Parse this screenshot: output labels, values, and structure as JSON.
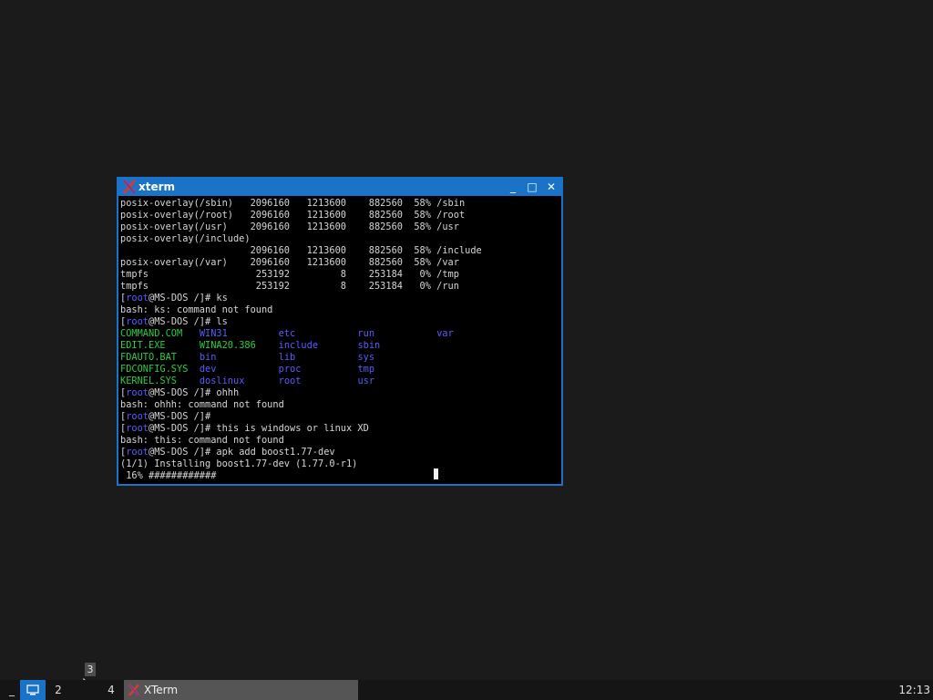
{
  "window": {
    "title": "xterm",
    "minimize_glyph": "_",
    "maximize_glyph": "□",
    "close_glyph": "✕"
  },
  "terminal": {
    "lines": [
      [
        {
          "t": "posix-overlay(/sbin)   2096160   1213600    882560  58% /sbin"
        }
      ],
      [
        {
          "t": "posix-overlay(/root)   2096160   1213600    882560  58% /root"
        }
      ],
      [
        {
          "t": "posix-overlay(/usr)    2096160   1213600    882560  58% /usr"
        }
      ],
      [
        {
          "t": "posix-overlay(/include)"
        }
      ],
      [
        {
          "t": "                       2096160   1213600    882560  58% /include"
        }
      ],
      [
        {
          "t": "posix-overlay(/var)    2096160   1213600    882560  58% /var"
        }
      ],
      [
        {
          "t": "tmpfs                   253192         8    253184   0% /tmp"
        }
      ],
      [
        {
          "t": "tmpfs                   253192         8    253184   0% /run"
        }
      ],
      [
        {
          "t": "["
        },
        {
          "t": "root",
          "c": "#5a5aff"
        },
        {
          "t": "@MS-DOS /]# ks"
        }
      ],
      [
        {
          "t": "bash: ks: command not found"
        }
      ],
      [
        {
          "t": "["
        },
        {
          "t": "root",
          "c": "#5a5aff"
        },
        {
          "t": "@MS-DOS /]# ls"
        }
      ],
      [
        {
          "t": "COMMAND.COM",
          "c": "#2ecc40"
        },
        {
          "t": "   "
        },
        {
          "t": "WIN31",
          "c": "#5a5aff"
        },
        {
          "t": "         "
        },
        {
          "t": "etc",
          "c": "#5a5aff"
        },
        {
          "t": "           "
        },
        {
          "t": "run",
          "c": "#5a5aff"
        },
        {
          "t": "           "
        },
        {
          "t": "var",
          "c": "#5a5aff"
        }
      ],
      [
        {
          "t": "EDIT.EXE",
          "c": "#2ecc40"
        },
        {
          "t": "      "
        },
        {
          "t": "WINA20.386",
          "c": "#2ecc40"
        },
        {
          "t": "    "
        },
        {
          "t": "include",
          "c": "#5a5aff"
        },
        {
          "t": "       "
        },
        {
          "t": "sbin",
          "c": "#5a5aff"
        }
      ],
      [
        {
          "t": "FDAUTO.BAT",
          "c": "#2ecc40"
        },
        {
          "t": "    "
        },
        {
          "t": "bin",
          "c": "#5a5aff"
        },
        {
          "t": "           "
        },
        {
          "t": "lib",
          "c": "#5a5aff"
        },
        {
          "t": "           "
        },
        {
          "t": "sys",
          "c": "#5a5aff"
        }
      ],
      [
        {
          "t": "FDCONFIG.SYS",
          "c": "#2ecc40"
        },
        {
          "t": "  "
        },
        {
          "t": "dev",
          "c": "#5a5aff"
        },
        {
          "t": "           "
        },
        {
          "t": "proc",
          "c": "#5a5aff"
        },
        {
          "t": "          "
        },
        {
          "t": "tmp",
          "c": "#5a5aff"
        }
      ],
      [
        {
          "t": "KERNEL.SYS",
          "c": "#2ecc40"
        },
        {
          "t": "    "
        },
        {
          "t": "doslinux",
          "c": "#5a5aff"
        },
        {
          "t": "      "
        },
        {
          "t": "root",
          "c": "#5a5aff"
        },
        {
          "t": "          "
        },
        {
          "t": "usr",
          "c": "#5a5aff"
        }
      ],
      [
        {
          "t": "["
        },
        {
          "t": "root",
          "c": "#5a5aff"
        },
        {
          "t": "@MS-DOS /]# ohhh"
        }
      ],
      [
        {
          "t": "bash: ohhh: command not found"
        }
      ],
      [
        {
          "t": "["
        },
        {
          "t": "root",
          "c": "#5a5aff"
        },
        {
          "t": "@MS-DOS /]#"
        }
      ],
      [
        {
          "t": "["
        },
        {
          "t": "root",
          "c": "#5a5aff"
        },
        {
          "t": "@MS-DOS /]# this is windows or linux XD"
        }
      ],
      [
        {
          "t": "bash: this: command not found"
        }
      ],
      [
        {
          "t": "["
        },
        {
          "t": "root",
          "c": "#5a5aff"
        },
        {
          "t": "@MS-DOS /]# apk add boost1.77-dev"
        }
      ],
      [
        {
          "t": "(1/1) Installing boost1.77-dev (1.77.0-r1)"
        }
      ],
      [
        {
          "t": " 16% ############"
        }
      ]
    ]
  },
  "taskbar": {
    "workspaces": [
      {
        "label": "_",
        "active": false
      },
      {
        "label": "",
        "active": true
      },
      {
        "label": "2",
        "active": false
      },
      {
        "label": "",
        "active": false
      },
      {
        "label": "4",
        "active": false
      }
    ],
    "task_label": "XTerm",
    "clock": "12:13",
    "tooltip": "3"
  },
  "colors": {
    "accent": "#1a73c7",
    "desktop": "#1b1b1b",
    "terminal_bg": "#000000",
    "terminal_fg": "#d6d6d6",
    "exec_green": "#2ecc40",
    "dir_blue": "#5a5aff"
  }
}
